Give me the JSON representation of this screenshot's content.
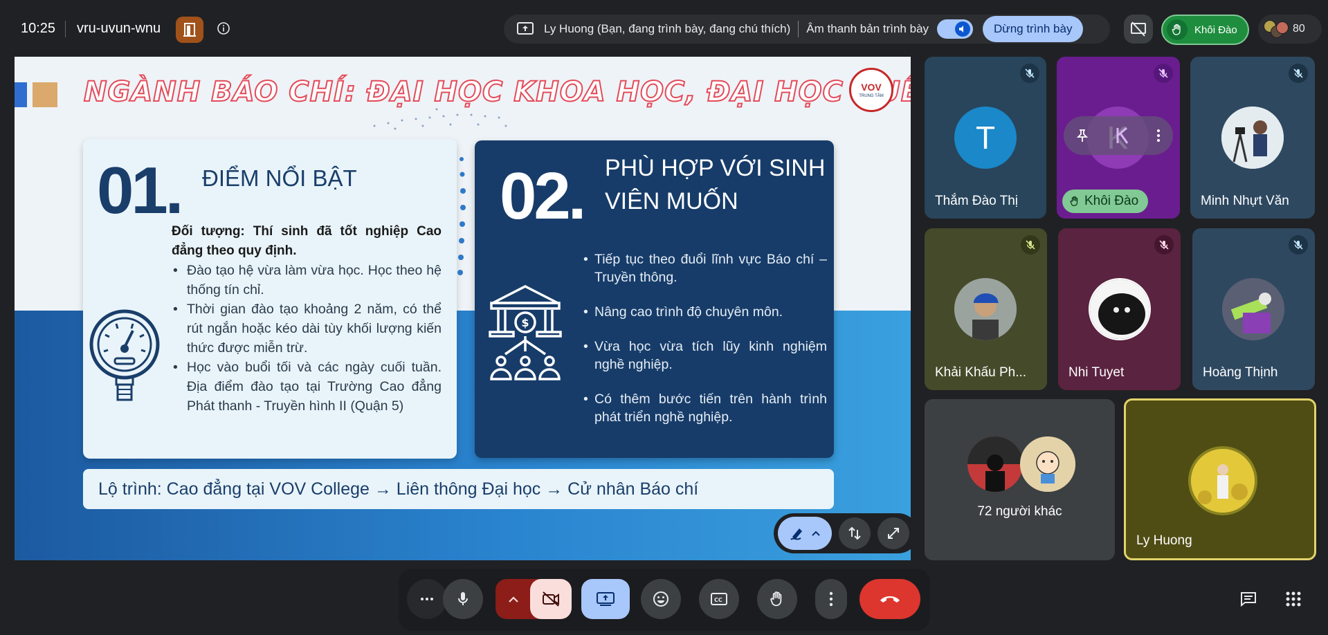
{
  "topbar": {
    "time": "10:25",
    "meeting_code": "vru-uvun-wnu",
    "presenting_text": "Ly Huong (Bạn, đang trình bày, đang chú thích)",
    "presentation_audio": "Âm thanh bản trình bày",
    "stop_presenting": "Dừng trình bày",
    "raised_hand_name": "Khôi Đào",
    "participant_count": "80"
  },
  "slide": {
    "title": "NGÀNH BÁO CHÍ: ĐẠI HỌC KHOA HỌC, ĐẠI HỌC HUẾ",
    "logo_text": "VOV",
    "logo_sub": "TRUNG TÂM",
    "card1": {
      "number": "01.",
      "title": "ĐIỂM NỔI BẬT",
      "subject": "Đối tượng: Thí sinh đã tốt nghiệp Cao đẳng theo quy định.",
      "bullets": [
        "Đào tạo hệ vừa làm vừa học. Học theo hệ thống tín chỉ.",
        "Thời gian đào tạo khoảng 2 năm, có thể rút ngắn hoặc kéo dài tùy khối lượng kiến thức được miễn trừ.",
        "Học vào buổi tối và các ngày cuối tuần. Địa điểm đào tạo tại Trường Cao đẳng Phát thanh - Truyền hình II (Quận 5)"
      ]
    },
    "card2": {
      "number": "02.",
      "title": "PHÙ HỢP VỚI SINH VIÊN MUỐN",
      "bullets": [
        "Tiếp tục theo đuổi lĩnh vực Báo chí – Truyền thông.",
        "Nâng cao trình độ chuyên môn.",
        "Vừa học vừa tích lũy kinh nghiệm nghề nghiệp.",
        "Có thêm bước tiến trên hành trình phát triển nghề nghiệp."
      ]
    },
    "roadmap": "Lộ trình: Cao đẳng tại VOV College → Liên thông Đại học → Cử nhân Báo chí"
  },
  "participants": {
    "t1": {
      "name": "Thắm Đào Thị",
      "initial": "T"
    },
    "t2": {
      "name": "Khôi Đào",
      "initial": "K"
    },
    "t3": {
      "name": "Minh Nhựt Văn"
    },
    "t4": {
      "name": "Khải Khấu Ph..."
    },
    "t5": {
      "name": "Nhi Tuyet"
    },
    "t6": {
      "name": "Hoàng Thịnh"
    },
    "others": "72 người khác",
    "self": "Ly Huong"
  },
  "colors": {
    "accent_blue": "#a8c7fa",
    "end_call": "#dc362e",
    "hand_green": "#81c995",
    "card_dark": "#173c69"
  }
}
